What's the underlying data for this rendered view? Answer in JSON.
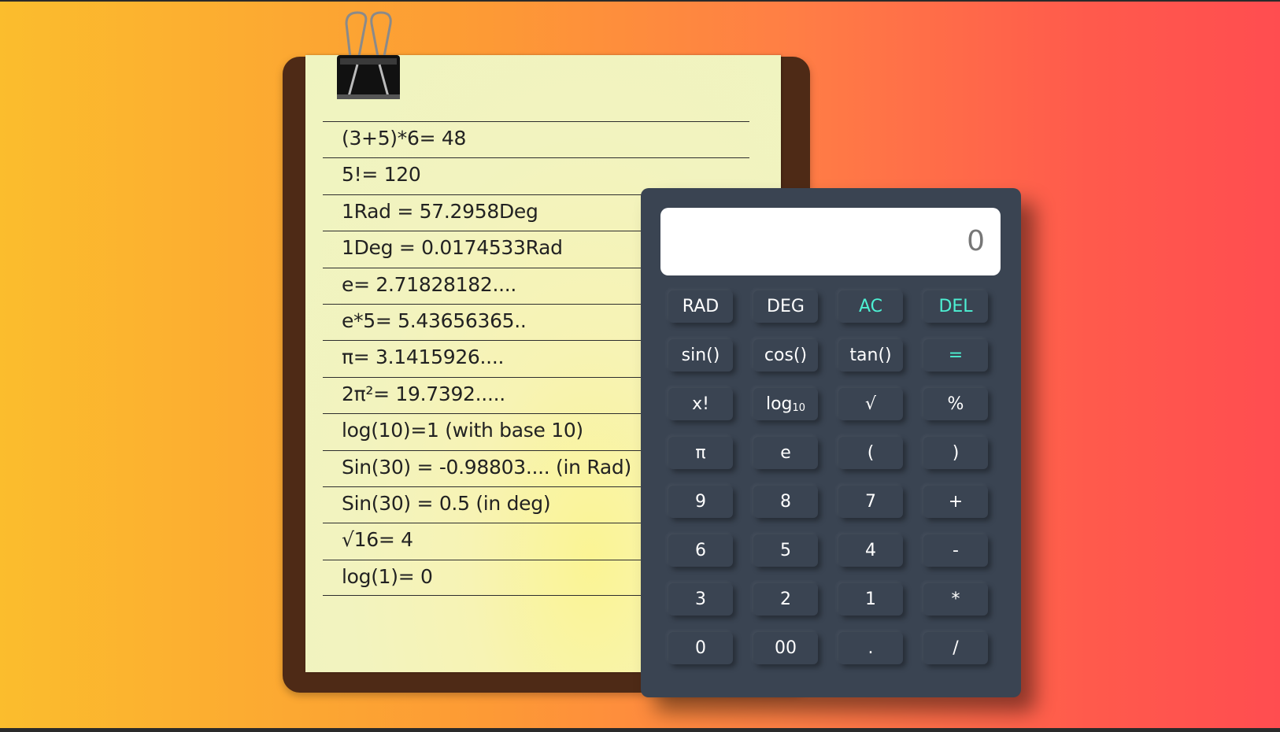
{
  "notes": [
    "(3+5)*6= 48",
    "5!= 120",
    "1Rad = 57.2958Deg",
    "1Deg = 0.0174533Rad",
    "e= 2.71828182....",
    "e*5= 5.43656365..",
    "π= 3.1415926....",
    "2π²= 19.7392.....",
    "log(10)=1 (with base 10)",
    "Sin(30) = -0.98803.... (in Rad)",
    "Sin(30) = 0.5 (in deg)",
    "√16= 4",
    "log(1)= 0"
  ],
  "calculator": {
    "display_value": "0",
    "accent_color": "#4df0d3",
    "keys": {
      "rad": "RAD",
      "deg": "DEG",
      "ac": "AC",
      "del": "DEL",
      "sin": "sin()",
      "cos": "cos()",
      "tan": "tan()",
      "equals": "=",
      "factorial": "x!",
      "log_base": "log",
      "log_sub": "10",
      "sqrt": "√",
      "percent": "%",
      "pi": "π",
      "e": "e",
      "open_paren": "(",
      "close_paren": ")",
      "nine": "9",
      "eight": "8",
      "seven": "7",
      "plus": "+",
      "six": "6",
      "five": "5",
      "four": "4",
      "minus": "-",
      "three": "3",
      "two": "2",
      "one": "1",
      "multiply": "*",
      "zero": "0",
      "double_zero": "00",
      "dot": ".",
      "divide": "/"
    }
  },
  "colors": {
    "board": "#4e2a16",
    "paper": "#eff4c0",
    "calculator_body": "#3a4452"
  }
}
